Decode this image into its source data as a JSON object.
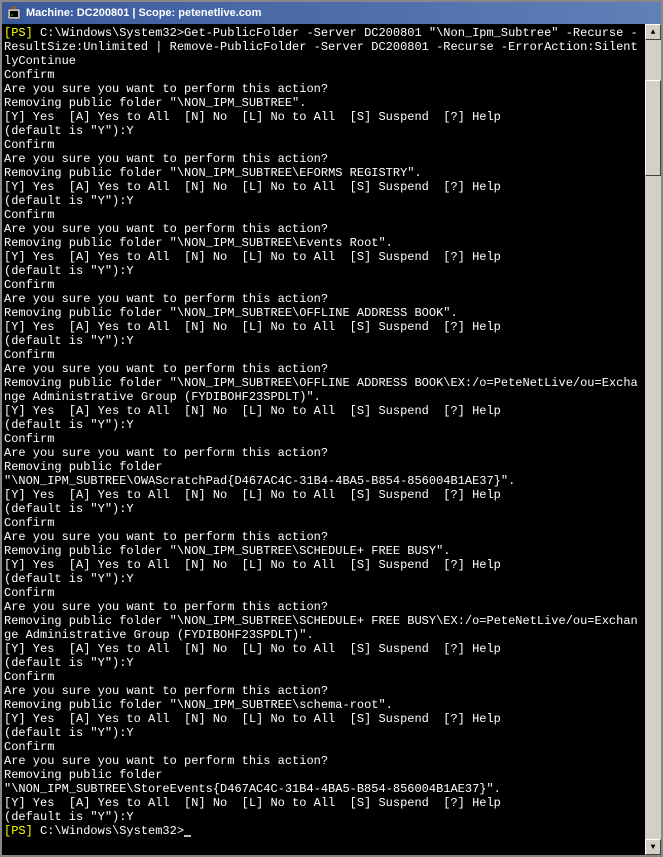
{
  "window": {
    "title": "Machine: DC200801 | Scope: petenetlive.com"
  },
  "prompt": {
    "ps_label": "[PS]",
    "path": " C:\\Windows\\System32>",
    "command": "Get-PublicFolder -Server DC200801 \"\\Non_Ipm_Subtree\" -Recurse -ResultSize:Unlimited | Remove-PublicFolder -Server DC200801 -Recurse -ErrorAction:SilentlyContinue"
  },
  "options_line": "[Y] Yes  [A] Yes to All  [N] No  [L] No to All  [S] Suspend  [?] Help",
  "default_line": "(default is \"Y\"):Y",
  "confirm_label": "Confirm",
  "question_line": "Are you sure you want to perform this action?",
  "removing_prefix": "Removing public folder ",
  "blocks": [
    {
      "folder": "\"\\NON_IPM_SUBTREE\"."
    },
    {
      "folder": "\"\\NON_IPM_SUBTREE\\EFORMS REGISTRY\"."
    },
    {
      "folder": "\"\\NON_IPM_SUBTREE\\Events Root\"."
    },
    {
      "folder": "\"\\NON_IPM_SUBTREE\\OFFLINE ADDRESS BOOK\"."
    },
    {
      "folder": "\"\\NON_IPM_SUBTREE\\OFFLINE ADDRESS BOOK\\EX:/o=PeteNetLive/ou=Exchange Administrative Group (FYDIBOHF23SPDLT)\"."
    },
    {
      "folder": "\"\\NON_IPM_SUBTREE\\OWAScratchPad{D467AC4C-31B4-4BA5-B854-856004B1AE37}\"."
    },
    {
      "folder": "\"\\NON_IPM_SUBTREE\\SCHEDULE+ FREE BUSY\"."
    },
    {
      "folder": "\"\\NON_IPM_SUBTREE\\SCHEDULE+ FREE BUSY\\EX:/o=PeteNetLive/ou=Exchange Administrative Group (FYDIBOHF23SPDLT)\"."
    },
    {
      "folder": "\"\\NON_IPM_SUBTREE\\schema-root\"."
    },
    {
      "folder": "\"\\NON_IPM_SUBTREE\\StoreEvents{D467AC4C-31B4-4BA5-B854-856004B1AE37}\"."
    }
  ],
  "final_prompt": {
    "ps_label": "[PS]",
    "path": " C:\\Windows\\System32>"
  }
}
